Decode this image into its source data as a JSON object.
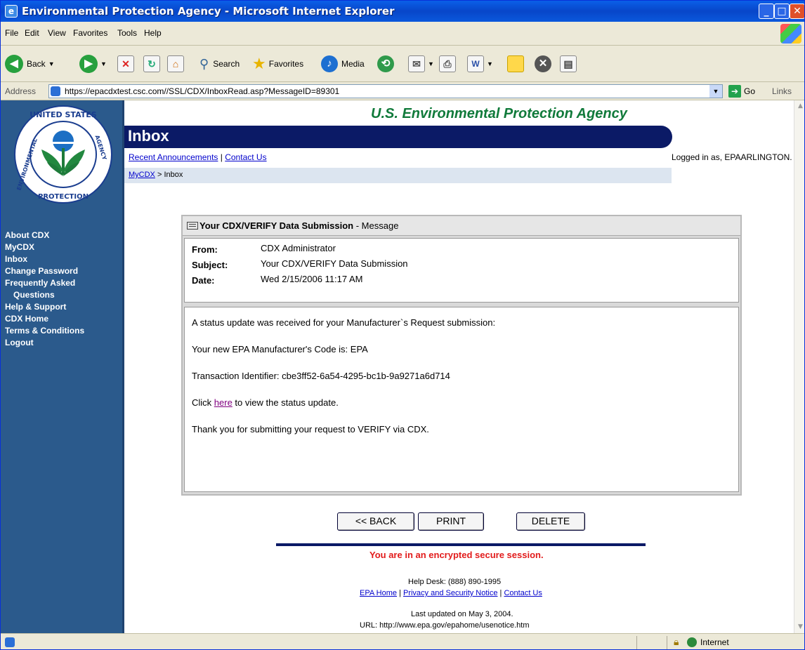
{
  "window": {
    "title": "Environmental Protection Agency - Microsoft Internet Explorer"
  },
  "menu": [
    "File",
    "Edit",
    "View",
    "Favorites",
    "Tools",
    "Help"
  ],
  "toolbar": {
    "back": "Back",
    "search": "Search",
    "favorites": "Favorites",
    "media": "Media"
  },
  "address": {
    "label": "Address",
    "url": "https://epacdxtest.csc.com//SSL/CDX/InboxRead.asp?MessageID=89301",
    "go": "Go",
    "links": "Links"
  },
  "header": {
    "agency": "U.S. Environmental Protection Agency",
    "page_title": "Inbox",
    "links": [
      "Recent Announcements",
      "Contact Us"
    ],
    "logged_in": "Logged in as, EPAARLINGTON.",
    "breadcrumb_link": "MyCDX",
    "breadcrumb_sep": ">",
    "breadcrumb_current": "Inbox"
  },
  "sidebar": {
    "seal_top": "UNITED STATES",
    "seal_left": "ENVIRONMENTAL",
    "seal_right": "AGENCY",
    "seal_bottom": "PROTECTION",
    "nav": [
      "About CDX",
      "MyCDX",
      "Inbox",
      "Change Password",
      "Frequently Asked",
      "Questions",
      "Help & Support",
      "CDX Home",
      "Terms & Conditions",
      "Logout"
    ]
  },
  "message": {
    "title": "Your CDX/VERIFY Data Submission",
    "title_suffix": " - Message",
    "from_label": "From:",
    "from": "CDX Administrator",
    "subject_label": "Subject:",
    "subject": "Your CDX/VERIFY Data Submission",
    "date_label": "Date:",
    "date": "Wed 2/15/2006 11:17 AM",
    "line1": "A status update was received for your Manufacturer`s Request submission:",
    "line2": "Your new EPA Manufacturer's Code is: EPA",
    "line3": "Transaction Identifier: cbe3ff52-6a54-4295-bc1b-9a9271a6d714",
    "line4_pre": "Click ",
    "line4_link": "here",
    "line4_post": " to view the status update.",
    "line5": "Thank you for submitting your request to VERIFY via CDX."
  },
  "buttons": {
    "back": "<< BACK",
    "print": "PRINT",
    "delete": "DELETE"
  },
  "footer": {
    "secure": "You are in an encrypted secure session.",
    "helpdesk": "Help Desk: (888) 890-1995",
    "links": [
      "EPA Home",
      "Privacy and Security Notice",
      "Contact Us"
    ],
    "updated": "Last updated on May 3, 2004.",
    "url": "URL: http://www.epa.gov/epahome/usenotice.htm"
  },
  "status": {
    "zone": "Internet"
  },
  "colors": {
    "sidebar": "#2b5a8c",
    "banner": "#0b1a66",
    "agency_green": "#107a3a",
    "secure_red": "#e21b1b"
  }
}
